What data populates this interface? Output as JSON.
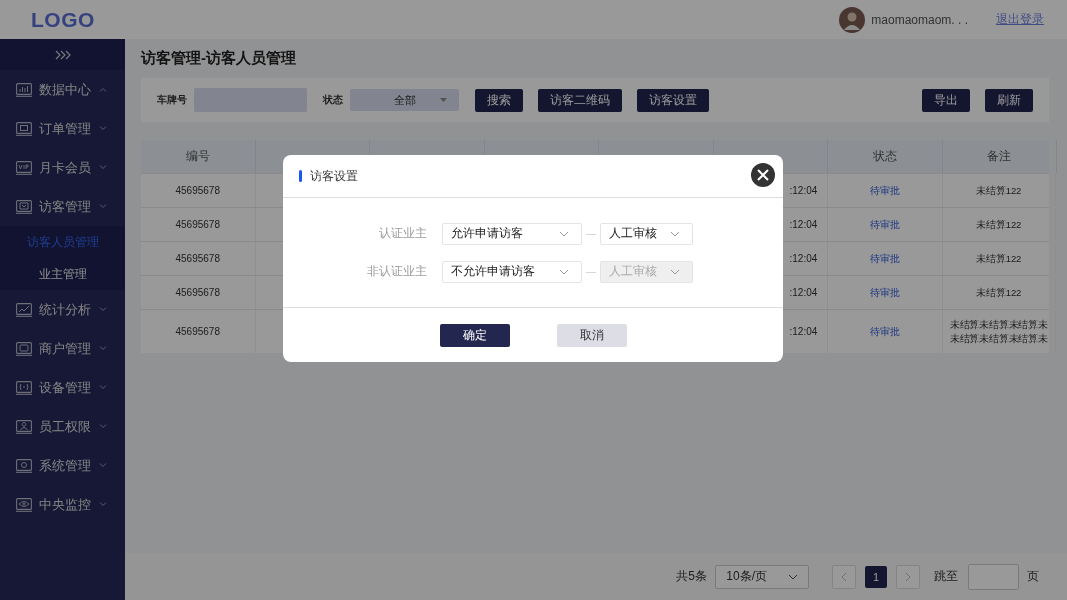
{
  "header": {
    "logo": "LOGO",
    "user_name": "maomaomaom. . .",
    "logout": "退出登录"
  },
  "sidebar": {
    "items": [
      {
        "label": "数据中心",
        "expanded": true
      },
      {
        "label": "订单管理",
        "expanded": false
      },
      {
        "label": "月卡会员",
        "expanded": false
      },
      {
        "label": "访客管理",
        "expanded": false,
        "children": [
          {
            "label": "访客人员管理",
            "selected": true
          },
          {
            "label": "业主管理",
            "selected": false
          }
        ]
      },
      {
        "label": "统计分析",
        "expanded": false
      },
      {
        "label": "商户管理",
        "expanded": false
      },
      {
        "label": "设备管理",
        "expanded": false
      },
      {
        "label": "员工权限",
        "expanded": false
      },
      {
        "label": "系统管理",
        "expanded": false
      },
      {
        "label": "中央监控",
        "expanded": false
      }
    ]
  },
  "page_title": "访客管理-访客人员管理",
  "filters": {
    "plate_label": "车牌号",
    "status_label": "状态",
    "status_value": "全部",
    "buttons": [
      "搜索",
      "访客二维码",
      "访客设置"
    ],
    "right_buttons": [
      "导出",
      "刷新"
    ]
  },
  "table": {
    "columns": [
      "编号",
      "状态",
      "备注"
    ],
    "rows": [
      {
        "id": "45695678",
        "end_time": ":12:04",
        "status": "待审批",
        "note": "未结算122"
      },
      {
        "id": "45695678",
        "end_time": ":12:04",
        "status": "待审批",
        "note": "未结算122"
      },
      {
        "id": "45695678",
        "end_time": ":12:04",
        "status": "待审批",
        "note": "未结算122"
      },
      {
        "id": "45695678",
        "end_time": ":12:04",
        "status": "待审批",
        "note": "未结算122"
      },
      {
        "id": "45695678",
        "end_time": ":12:04",
        "status": "待审批",
        "note": "未结算未结算未结算未未结算未结算未结算未"
      }
    ]
  },
  "pagination": {
    "total": "共5条",
    "page_size": "10条/页",
    "pages": [
      {
        "label": "1",
        "selected": true
      }
    ],
    "jump_label": "跳至",
    "page_unit": "页"
  },
  "modal": {
    "title": "访客设置",
    "rows": [
      {
        "label": "认证业主",
        "mode": {
          "value": "允许申请访客",
          "disabled": false
        },
        "separator": "—",
        "review": {
          "value": "人工审核",
          "disabled": false
        }
      },
      {
        "label": "非认证业主",
        "mode": {
          "value": "不允许申请访客",
          "disabled": false
        },
        "separator": "—",
        "review": {
          "value": "人工审核",
          "disabled": true
        }
      }
    ],
    "confirm": "确定",
    "cancel": "取消"
  }
}
